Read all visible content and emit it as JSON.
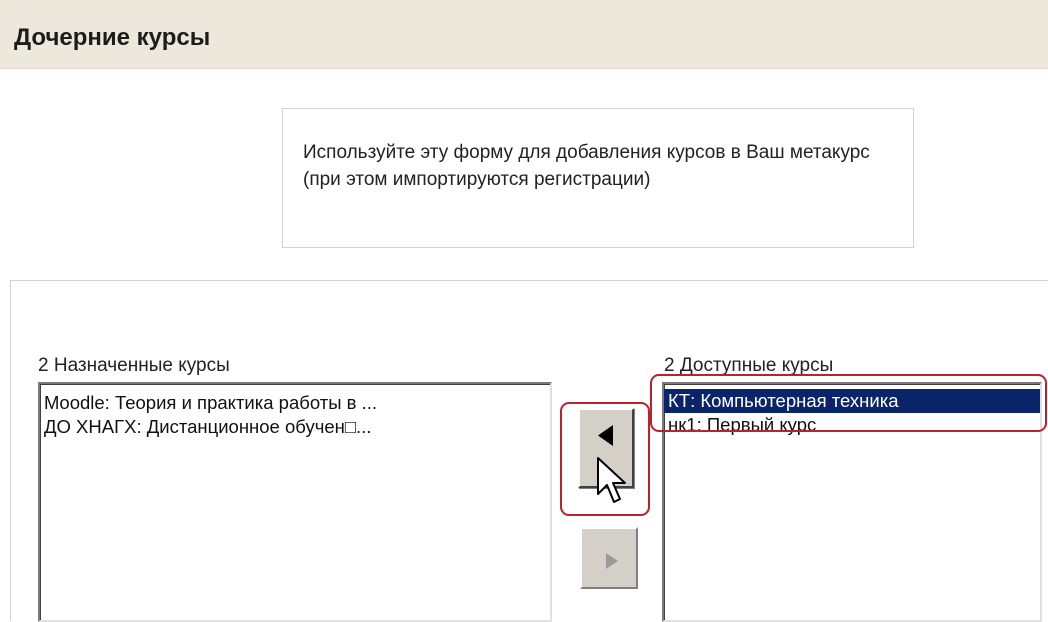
{
  "header": {
    "title": "Дочерние курсы"
  },
  "intro": {
    "text": "Используйте эту форму для добавления курсов в Ваш метакурс (при этом импортируются регистрации)"
  },
  "assigned": {
    "label": "2 Назначенные курсы",
    "items": [
      "Moodle: Теория и практика работы в ...",
      "ДО ХНАГХ: Дистанционное обучен□..."
    ]
  },
  "available": {
    "label": "2 Доступные курсы",
    "items": [
      "КТ: Компьютерная техника",
      "нк1: Первый курс"
    ],
    "selected_index": 0
  },
  "buttons": {
    "add": {
      "icon": "arrow-left-icon",
      "state": "enabled"
    },
    "remove": {
      "icon": "arrow-right-icon",
      "state": "disabled"
    }
  },
  "colors": {
    "header_bg": "#ece8dc",
    "selection_bg": "#0a246a",
    "callout": "#b8232f",
    "button_face": "#d4d0c8"
  }
}
